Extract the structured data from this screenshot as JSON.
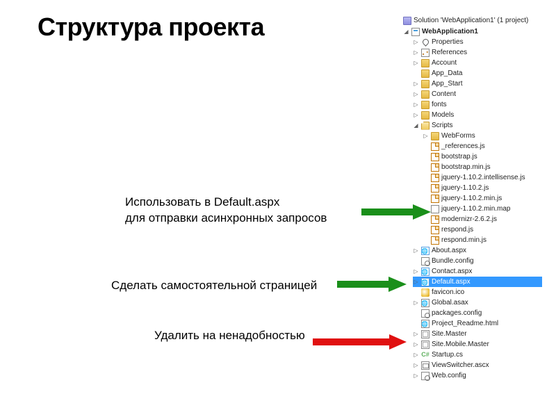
{
  "title": "Структура проекта",
  "annotations": {
    "use_in_default_line1": "Использовать в Default.aspx",
    "use_in_default_line2": "для отправки асинхронных запросов",
    "make_standalone": "Сделать самостоятельной страницей",
    "delete_unneeded": "Удалить на ненадобностью"
  },
  "solution": {
    "header": "Solution 'WebApplication1' (1 project)",
    "project": "WebApplication1",
    "items": {
      "properties": "Properties",
      "references": "References",
      "account": "Account",
      "app_data": "App_Data",
      "app_start": "App_Start",
      "content": "Content",
      "fonts": "fonts",
      "models": "Models",
      "scripts": "Scripts",
      "webforms": "WebForms",
      "refjs": "_references.js",
      "bootstrap": "bootstrap.js",
      "bootstrapmin": "bootstrap.min.js",
      "jqis": "jquery-1.10.2.intellisense.js",
      "jq": "jquery-1.10.2.js",
      "jqmin": "jquery-1.10.2.min.js",
      "jqmap": "jquery-1.10.2.min.map",
      "modernizr": "modernizr-2.6.2.js",
      "respond": "respond.js",
      "respondmin": "respond.min.js",
      "about": "About.aspx",
      "bundle": "Bundle.config",
      "contact": "Contact.aspx",
      "default": "Default.aspx",
      "favicon": "favicon.ico",
      "global": "Global.asax",
      "packages": "packages.config",
      "readme": "Project_Readme.html",
      "sitemaster": "Site.Master",
      "sitemobile": "Site.Mobile.Master",
      "startup": "Startup.cs",
      "viewswitcher": "ViewSwitcher.ascx",
      "webconfig": "Web.config"
    }
  },
  "arrows": {
    "green": "#1a8f1a",
    "red": "#e01010"
  }
}
